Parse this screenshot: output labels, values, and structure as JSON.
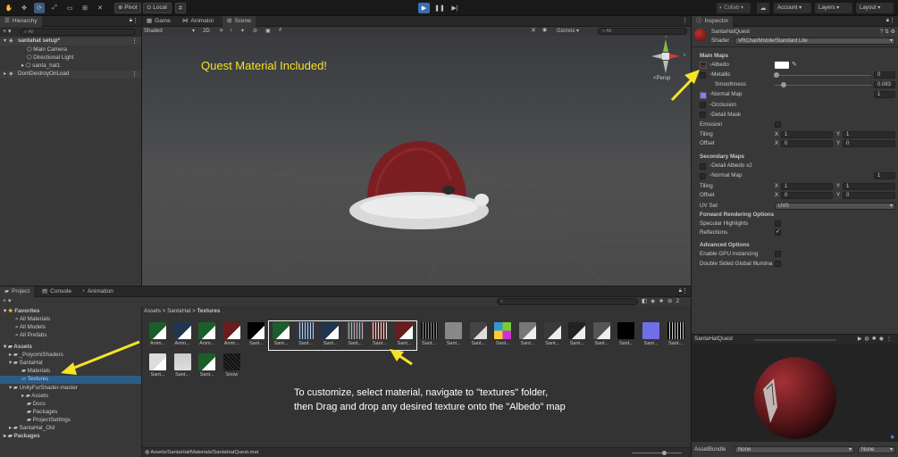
{
  "toolbar": {
    "pivot_label": "Pivot",
    "local_label": "Local",
    "collab_label": "Collab",
    "account_label": "Account",
    "layers_label": "Layers",
    "layout_label": "Layout"
  },
  "hierarchy": {
    "tab": "Hierarchy",
    "search_placeholder": "All",
    "scene": "santahat setup*",
    "items": [
      "Main Camera",
      "Directional Light",
      "santa_hat1"
    ],
    "dont_destroy": "DontDestroyOnLoad"
  },
  "scene_view": {
    "tabs": [
      "Game",
      "Animator",
      "Scene"
    ],
    "shading_mode": "Shaded",
    "shading_2d": "2D",
    "gizmos": "Gizmos",
    "gizmos_search": "All",
    "persp": "Persp",
    "axis_x": "x",
    "axis_y": "y",
    "annotation": "Quest Material Included!"
  },
  "project": {
    "tabs": [
      "Project",
      "Console",
      "Animation"
    ],
    "favorites": "Favorites",
    "fav_items": [
      "All Materials",
      "All Models",
      "All Prefabs"
    ],
    "assets": "Assets",
    "tree": [
      "_PoiyomiShaders",
      "SantaHat",
      "Materials",
      "Textures",
      "UnityFurShader-master",
      "Assets",
      "Docs",
      "Packages",
      "ProjectSettings",
      "SantaHat_Old"
    ],
    "packages": "Packages",
    "breadcrumb": [
      "Assets",
      "SantaHat",
      "Textures"
    ],
    "thumb_labels_row1": [
      "Anim...",
      "Anim...",
      "Anim...",
      "Anim...",
      "Sant...",
      "Sant...",
      "Sant...",
      "Sant...",
      "Sant...",
      "Sant...",
      "Sant...",
      "Sant...",
      "Sant...",
      "Sant...",
      "Sant...",
      "Sant...",
      "Sant...",
      "Sant...",
      "Sant...",
      "Sant...",
      "Sant...",
      "Sant..."
    ],
    "thumb_labels_row2": [
      "Sant...",
      "Sant...",
      "Sant...",
      "Snow"
    ],
    "status_path": "Assets/SantaHat/Materials/SantaHatQuest.mat",
    "hidden_count": "2",
    "instruction_line1": "To customize, select material, navigate to \"textures\" folder,",
    "instruction_line2": "then Drag and drop any desired texture onto the \"Albedo\" map"
  },
  "inspector": {
    "tab": "Inspector",
    "material_name": "SantaHatQuest",
    "shader_label": "Shader",
    "shader_value": "VRChat/Mobile/Standard Lite",
    "main_maps": "Main Maps",
    "albedo": "Albedo",
    "metallic": "Metallic",
    "metallic_value": "0",
    "smoothness": "Smoothness",
    "smoothness_value": "0.083",
    "normal_map": "Normal Map",
    "normal_value": "1",
    "occlusion": "Occlusion",
    "detail_mask": "Detail Mask",
    "emission": "Emission",
    "tiling": "Tiling",
    "offset": "Offset",
    "x_label": "X",
    "y_label": "Y",
    "tiling_x": "1",
    "tiling_y": "1",
    "offset_x": "0",
    "offset_y": "0",
    "secondary_maps": "Secondary Maps",
    "detail_albedo": "Detail Albedo x2",
    "sec_normal": "Normal Map",
    "sec_normal_value": "1",
    "sec_tiling_x": "1",
    "sec_tiling_y": "1",
    "sec_offset_x": "0",
    "sec_offset_y": "0",
    "uv_set": "UV Set",
    "uv_value": "UV0",
    "forward_options": "Forward Rendering Options",
    "specular": "Specular Highlights",
    "reflections": "Reflections",
    "advanced": "Advanced Options",
    "gpu_instancing": "Enable GPU Instancing",
    "double_sided": "Double Sided Global Illumina",
    "preview_title": "SantaHatQuest",
    "asset_bundle": "AssetBundle",
    "bundle_value": "None",
    "bundle_variant": "None",
    "metallic_level": 0.0,
    "smoothness_level": 0.083
  },
  "colors": {
    "annotation_yellow": "#f5e32a",
    "accent_blue": "#4a7ec5",
    "hat_red": "#7a1e22",
    "selection": "#2c5d87"
  }
}
